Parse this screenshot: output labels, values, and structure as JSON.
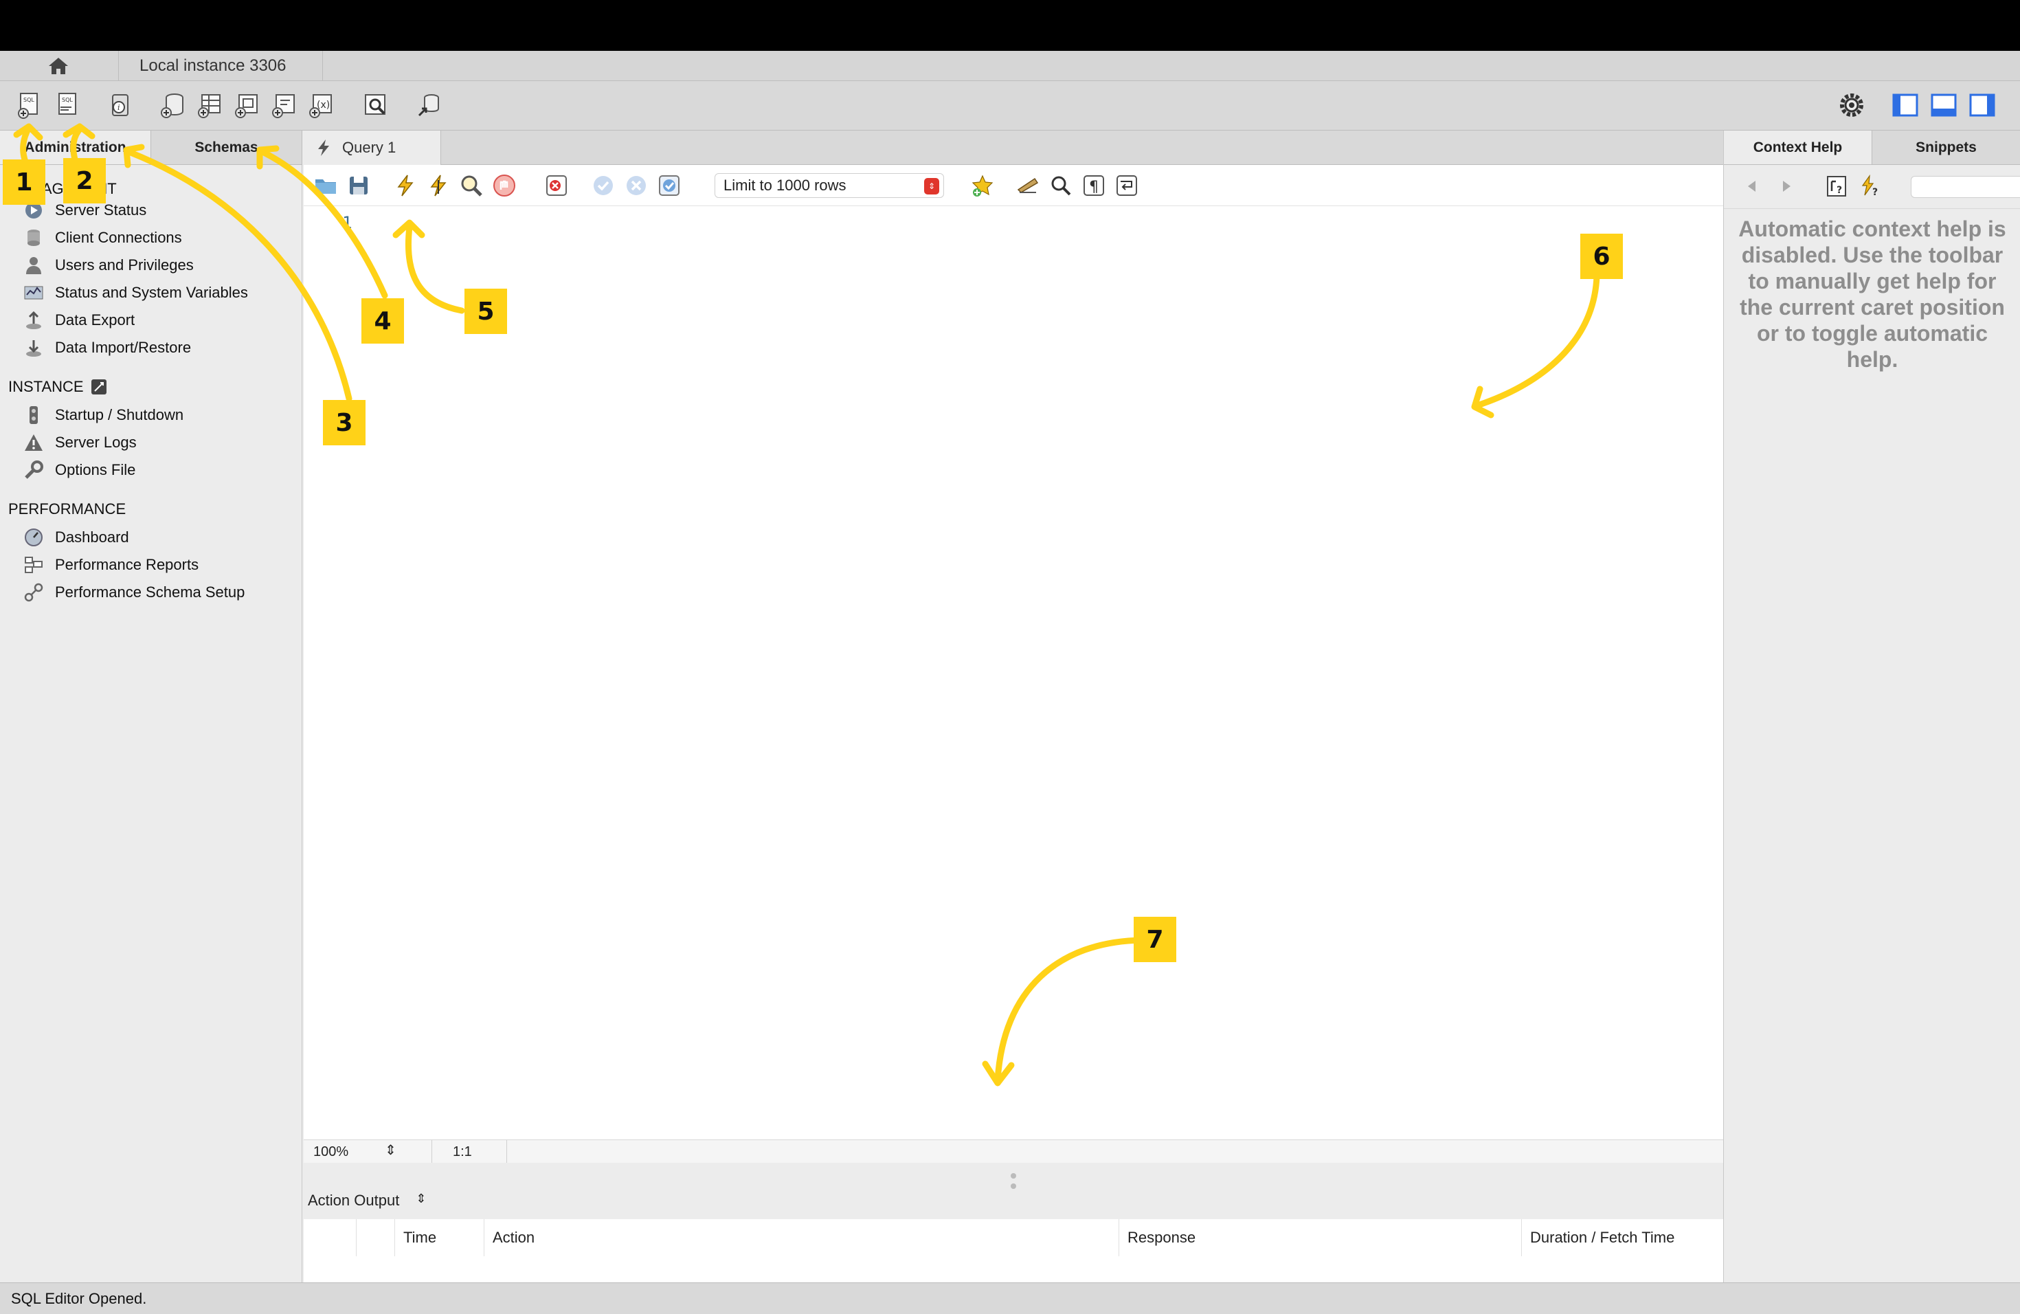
{
  "window": {
    "connection_tab": "Local instance 3306"
  },
  "sidebar": {
    "tabs": [
      "Administration",
      "Schemas"
    ],
    "sections": [
      {
        "title": "MANAGEMENT",
        "items": [
          "Server Status",
          "Client Connections",
          "Users and Privileges",
          "Status and System Variables",
          "Data Export",
          "Data Import/Restore"
        ]
      },
      {
        "title": "INSTANCE",
        "items": [
          "Startup / Shutdown",
          "Server Logs",
          "Options File"
        ]
      },
      {
        "title": "PERFORMANCE",
        "items": [
          "Dashboard",
          "Performance Reports",
          "Performance Schema Setup"
        ]
      }
    ]
  },
  "editor": {
    "query_tab": "Query 1",
    "limit_value": "Limit to 1000 rows",
    "line_number": "1",
    "zoom": "100%",
    "caret_position": "1:1"
  },
  "output": {
    "selector": "Action Output",
    "columns": [
      "Time",
      "Action",
      "Response",
      "Duration / Fetch Time"
    ]
  },
  "right_panel": {
    "tabs": [
      "Context Help",
      "Snippets"
    ],
    "help_text": "Automatic context help is disabled. Use the toolbar to manually get help for the current caret position or to toggle automatic help."
  },
  "statusbar": {
    "message": "SQL Editor Opened."
  },
  "annotations": [
    "1",
    "2",
    "3",
    "4",
    "5",
    "6",
    "7"
  ],
  "colors": {
    "annotation": "#ffd218",
    "panel_bg": "#ececec",
    "toolbar_bg": "#d9d9d9"
  }
}
